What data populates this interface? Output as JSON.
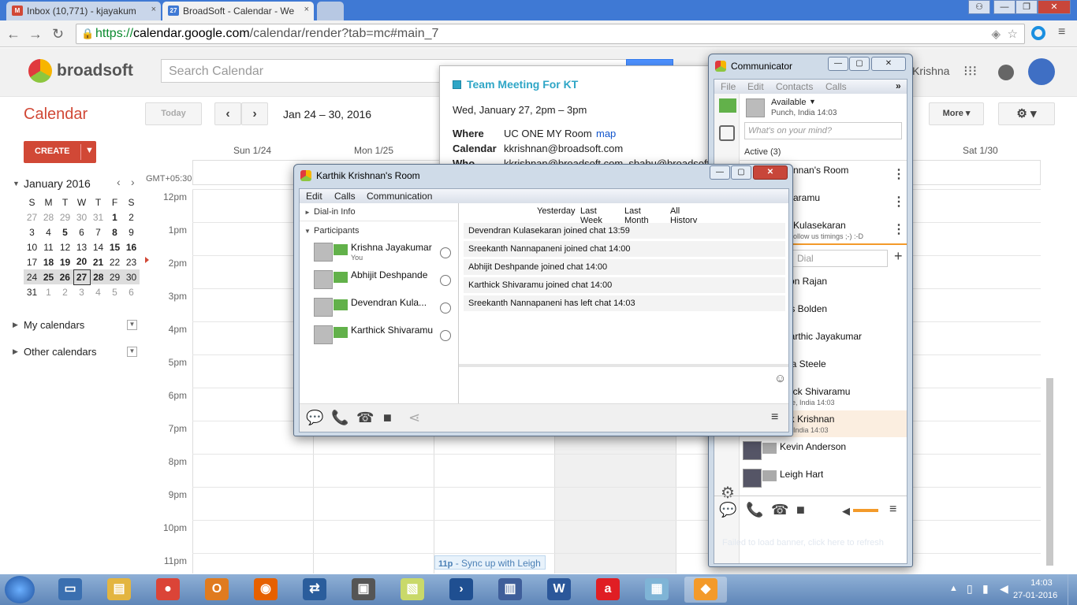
{
  "browser": {
    "tabs": [
      {
        "label": "Inbox (10,771) - kjayakum",
        "icon": "gmail-icon",
        "close": "×"
      },
      {
        "label": "BroadSoft - Calendar - We",
        "icon": "calendar-icon",
        "badge": "27",
        "close": "×"
      }
    ],
    "url_scheme": "https://",
    "url_host": "calendar.google.com",
    "url_path": "/calendar/render?tab=mc#main_7"
  },
  "calendar_header": {
    "logo_text": "broadsoft",
    "search_placeholder": "Search Calendar",
    "user_name": "Krishna"
  },
  "toolbar": {
    "app_title": "Calendar",
    "today_label": "Today",
    "date_range": "Jan 24 – 30, 2016",
    "more_label": "More ▾",
    "create_label": "CREATE"
  },
  "columns": {
    "sun": "Sun 1/24",
    "mon": "Mon 1/25",
    "sat": "Sat 1/30",
    "timezone": "GMT+05:30"
  },
  "hours": [
    "12pm",
    "1pm",
    "2pm",
    "3pm",
    "4pm",
    "5pm",
    "6pm",
    "7pm",
    "8pm",
    "9pm",
    "10pm",
    "11pm"
  ],
  "mini_calendar": {
    "month": "January 2016",
    "weekdays": [
      "S",
      "M",
      "T",
      "W",
      "T",
      "F",
      "S"
    ],
    "weeks": [
      [
        "27",
        "28",
        "29",
        "30",
        "31",
        "1",
        "2"
      ],
      [
        "3",
        "4",
        "5",
        "6",
        "7",
        "8",
        "9"
      ],
      [
        "10",
        "11",
        "12",
        "13",
        "14",
        "15",
        "16"
      ],
      [
        "17",
        "18",
        "19",
        "20",
        "21",
        "22",
        "23"
      ],
      [
        "24",
        "25",
        "26",
        "27",
        "28",
        "29",
        "30"
      ],
      [
        "31",
        "1",
        "2",
        "3",
        "4",
        "5",
        "6"
      ]
    ]
  },
  "sidebar": {
    "my_calendars": "My calendars",
    "other_calendars": "Other calendars"
  },
  "event_chip": {
    "time": "11p",
    "title": " - Sync up with Leigh"
  },
  "popup": {
    "title": "Team Meeting For KT",
    "when": "Wed, January 27, 2pm – 3pm",
    "where_label": "Where",
    "where_value": "UC ONE MY Room",
    "map_link": "map",
    "calendar_label": "Calendar",
    "calendar_value": "kkrishnan@broadsoft.com",
    "who_label": "Who",
    "who_value": "kkrishnan@broadsoft.com, sbabu@broadsoft"
  },
  "room": {
    "title": "Karthik Krishnan's Room",
    "menu": [
      "Edit",
      "Calls",
      "Communication"
    ],
    "dial_in": "Dial-in Info",
    "participants_label": "Participants",
    "participants": [
      {
        "name": "Krishna Jayakumar",
        "sub": "You"
      },
      {
        "name": "Abhijit Deshpande",
        "sub": ""
      },
      {
        "name": "Devendran Kula...",
        "sub": ""
      },
      {
        "name": "Karthick Shivaramu",
        "sub": ""
      }
    ],
    "history_filters": [
      "Yesterday",
      "Last Week",
      "Last Month",
      "All History"
    ],
    "history": [
      "Devendran Kulasekaran joined chat 13:59",
      "Sreekanth Nannapaneni joined chat 14:00",
      "Abhijit Deshpande joined chat 14:00",
      "Karthick Shivaramu joined chat 14:00",
      "Sreekanth Nannapaneni has left chat 14:03"
    ],
    "emoji": "☺"
  },
  "communicator": {
    "title": "Communicator",
    "menu": [
      "File",
      "Edit",
      "Contacts",
      "Calls"
    ],
    "status": "Available",
    "location": "Punch, India  14:03",
    "mind_placeholder": "What's on your mind?",
    "active_label": "Active (3)",
    "active": [
      {
        "name": "nnan's Room",
        "sub": ""
      },
      {
        "name": "aramu",
        "sub": ""
      },
      {
        "name": "Kulasekaran",
        "sub": "ollow us timings ;-) :-D"
      }
    ],
    "dial_placeholder": "Dial",
    "contacts": [
      {
        "name": "kson Rajan",
        "sub": "",
        "flag": "green"
      },
      {
        "name": "nes Bolden",
        "sub": "",
        "flag": "green"
      },
      {
        "name": "akarthic Jayakumar",
        "sub": "",
        "flag": "green"
      },
      {
        "name": "sica Steele",
        "sub": "",
        "flag": "green"
      },
      {
        "name": "rthick Shivaramu",
        "sub": "alore, India 14:03",
        "flag": "green"
      },
      {
        "name": "thik Krishnan",
        "sub": "nai, India 14:03",
        "flag": "green"
      },
      {
        "name": "Kevin Anderson",
        "sub": "",
        "flag": "grey"
      },
      {
        "name": "Leigh Hart",
        "sub": "",
        "flag": "grey"
      }
    ],
    "banner": "Failed to load banner, click here to refresh"
  },
  "taskbar": {
    "time": "14:03",
    "date": "27-01-2016"
  },
  "colors": {
    "accent_red": "#d14836",
    "google_blue": "#4d90fe",
    "flag_green": "#62b14a",
    "link_blue": "#1155cc"
  }
}
